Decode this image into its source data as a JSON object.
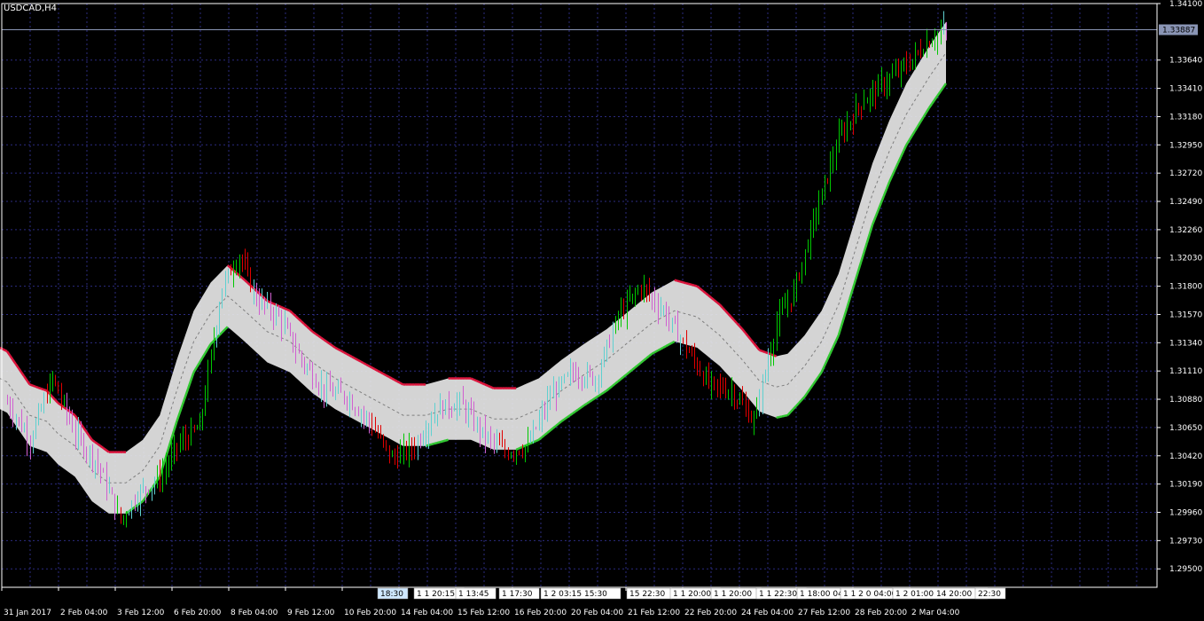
{
  "chart_data": {
    "type": "candlestick",
    "title": "USDCAD,H4",
    "ylim": [
      1.2935,
      1.341
    ],
    "y_ticks": [
      "1.34100",
      "1.33640",
      "1.33410",
      "1.33180",
      "1.32950",
      "1.32720",
      "1.32490",
      "1.32260",
      "1.32030",
      "1.31800",
      "1.31570",
      "1.31340",
      "1.31110",
      "1.30880",
      "1.30650",
      "1.30420",
      "1.30190",
      "1.29960",
      "1.29730",
      "1.29500"
    ],
    "current_price": "1.33887",
    "x_ticks": [
      "31 Jan 2017",
      "2 Feb 04:00",
      "3 Feb 12:00",
      "6 Feb 20:00",
      "8 Feb 04:00",
      "9 Feb 12:00",
      "10 Feb 20:00",
      "14 Feb 04:00",
      "15 Feb 12:00",
      "16 Feb 20:00",
      "20 Feb 04:00",
      "21 Feb 12:00",
      "22 Feb 20:00",
      "24 Feb 04:00",
      "27 Feb 12:00",
      "28 Feb 20:00",
      "2 Mar 04:00"
    ],
    "price_path": [
      [
        0,
        1.3085
      ],
      [
        8,
        1.3055
      ],
      [
        16,
        1.3105
      ],
      [
        24,
        1.306
      ],
      [
        32,
        1.3035
      ],
      [
        40,
        1.299
      ],
      [
        46,
        1.301
      ],
      [
        54,
        1.3025
      ],
      [
        60,
        1.305
      ],
      [
        68,
        1.3065
      ],
      [
        76,
        1.318
      ],
      [
        82,
        1.3205
      ],
      [
        88,
        1.317
      ],
      [
        96,
        1.3155
      ],
      [
        104,
        1.312
      ],
      [
        112,
        1.3095
      ],
      [
        120,
        1.309
      ],
      [
        128,
        1.307
      ],
      [
        136,
        1.304
      ],
      [
        144,
        1.305
      ],
      [
        152,
        1.308
      ],
      [
        160,
        1.3085
      ],
      [
        168,
        1.306
      ],
      [
        176,
        1.3045
      ],
      [
        184,
        1.305
      ],
      [
        192,
        1.309
      ],
      [
        200,
        1.311
      ],
      [
        208,
        1.3105
      ],
      [
        216,
        1.3155
      ],
      [
        224,
        1.318
      ],
      [
        232,
        1.316
      ],
      [
        240,
        1.313
      ],
      [
        248,
        1.31
      ],
      [
        256,
        1.3095
      ],
      [
        264,
        1.307
      ],
      [
        272,
        1.315
      ],
      [
        278,
        1.3175
      ],
      [
        286,
        1.324
      ],
      [
        294,
        1.33
      ],
      [
        302,
        1.333
      ],
      [
        310,
        1.3345
      ],
      [
        318,
        1.336
      ],
      [
        326,
        1.338
      ],
      [
        332,
        1.339
      ]
    ],
    "band_center": [
      [
        0,
        1.3102
      ],
      [
        8,
        1.3075
      ],
      [
        14,
        1.307
      ],
      [
        18,
        1.306
      ],
      [
        24,
        1.305
      ],
      [
        30,
        1.303
      ],
      [
        36,
        1.302
      ],
      [
        42,
        1.302
      ],
      [
        48,
        1.303
      ],
      [
        54,
        1.305
      ],
      [
        60,
        1.3095
      ],
      [
        66,
        1.3135
      ],
      [
        72,
        1.3158
      ],
      [
        78,
        1.3172
      ],
      [
        84,
        1.316
      ],
      [
        92,
        1.3143
      ],
      [
        100,
        1.3135
      ],
      [
        108,
        1.3118
      ],
      [
        116,
        1.3105
      ],
      [
        124,
        1.3095
      ],
      [
        132,
        1.3085
      ],
      [
        140,
        1.3075
      ],
      [
        148,
        1.3075
      ],
      [
        156,
        1.308
      ],
      [
        164,
        1.308
      ],
      [
        172,
        1.3072
      ],
      [
        180,
        1.3072
      ],
      [
        188,
        1.308
      ],
      [
        196,
        1.3095
      ],
      [
        204,
        1.3108
      ],
      [
        212,
        1.312
      ],
      [
        220,
        1.3135
      ],
      [
        228,
        1.315
      ],
      [
        236,
        1.316
      ],
      [
        244,
        1.3155
      ],
      [
        252,
        1.314
      ],
      [
        260,
        1.312
      ],
      [
        266,
        1.3103
      ],
      [
        272,
        1.3098
      ],
      [
        276,
        1.31
      ],
      [
        282,
        1.3115
      ],
      [
        288,
        1.3135
      ],
      [
        294,
        1.3165
      ],
      [
        300,
        1.321
      ],
      [
        306,
        1.3255
      ],
      [
        312,
        1.329
      ],
      [
        318,
        1.332
      ],
      [
        326,
        1.335
      ],
      [
        332,
        1.337
      ]
    ],
    "band_halfwidth": 0.0025,
    "colors": {
      "up_bar": "#00c800",
      "down_bar": "#e00000",
      "band_up": "#32c832",
      "band_down": "#dc143c",
      "band_fill": "#e6e6e6",
      "grid": "#2b2b80",
      "axis": "#ffffff",
      "price_line": "#8a95b5"
    },
    "events": [
      "18:30",
      "1 1 20:15",
      "1 13:45",
      "1 17:30",
      "1 2 03:15 15:30",
      "15 22:30",
      "1 1 20:00",
      "1 1 20:00",
      "1 1 22:30",
      "1 18:00 04",
      "1 1 2 0 04:00",
      "1 2 01:00 14 20:00",
      "22:30"
    ]
  }
}
